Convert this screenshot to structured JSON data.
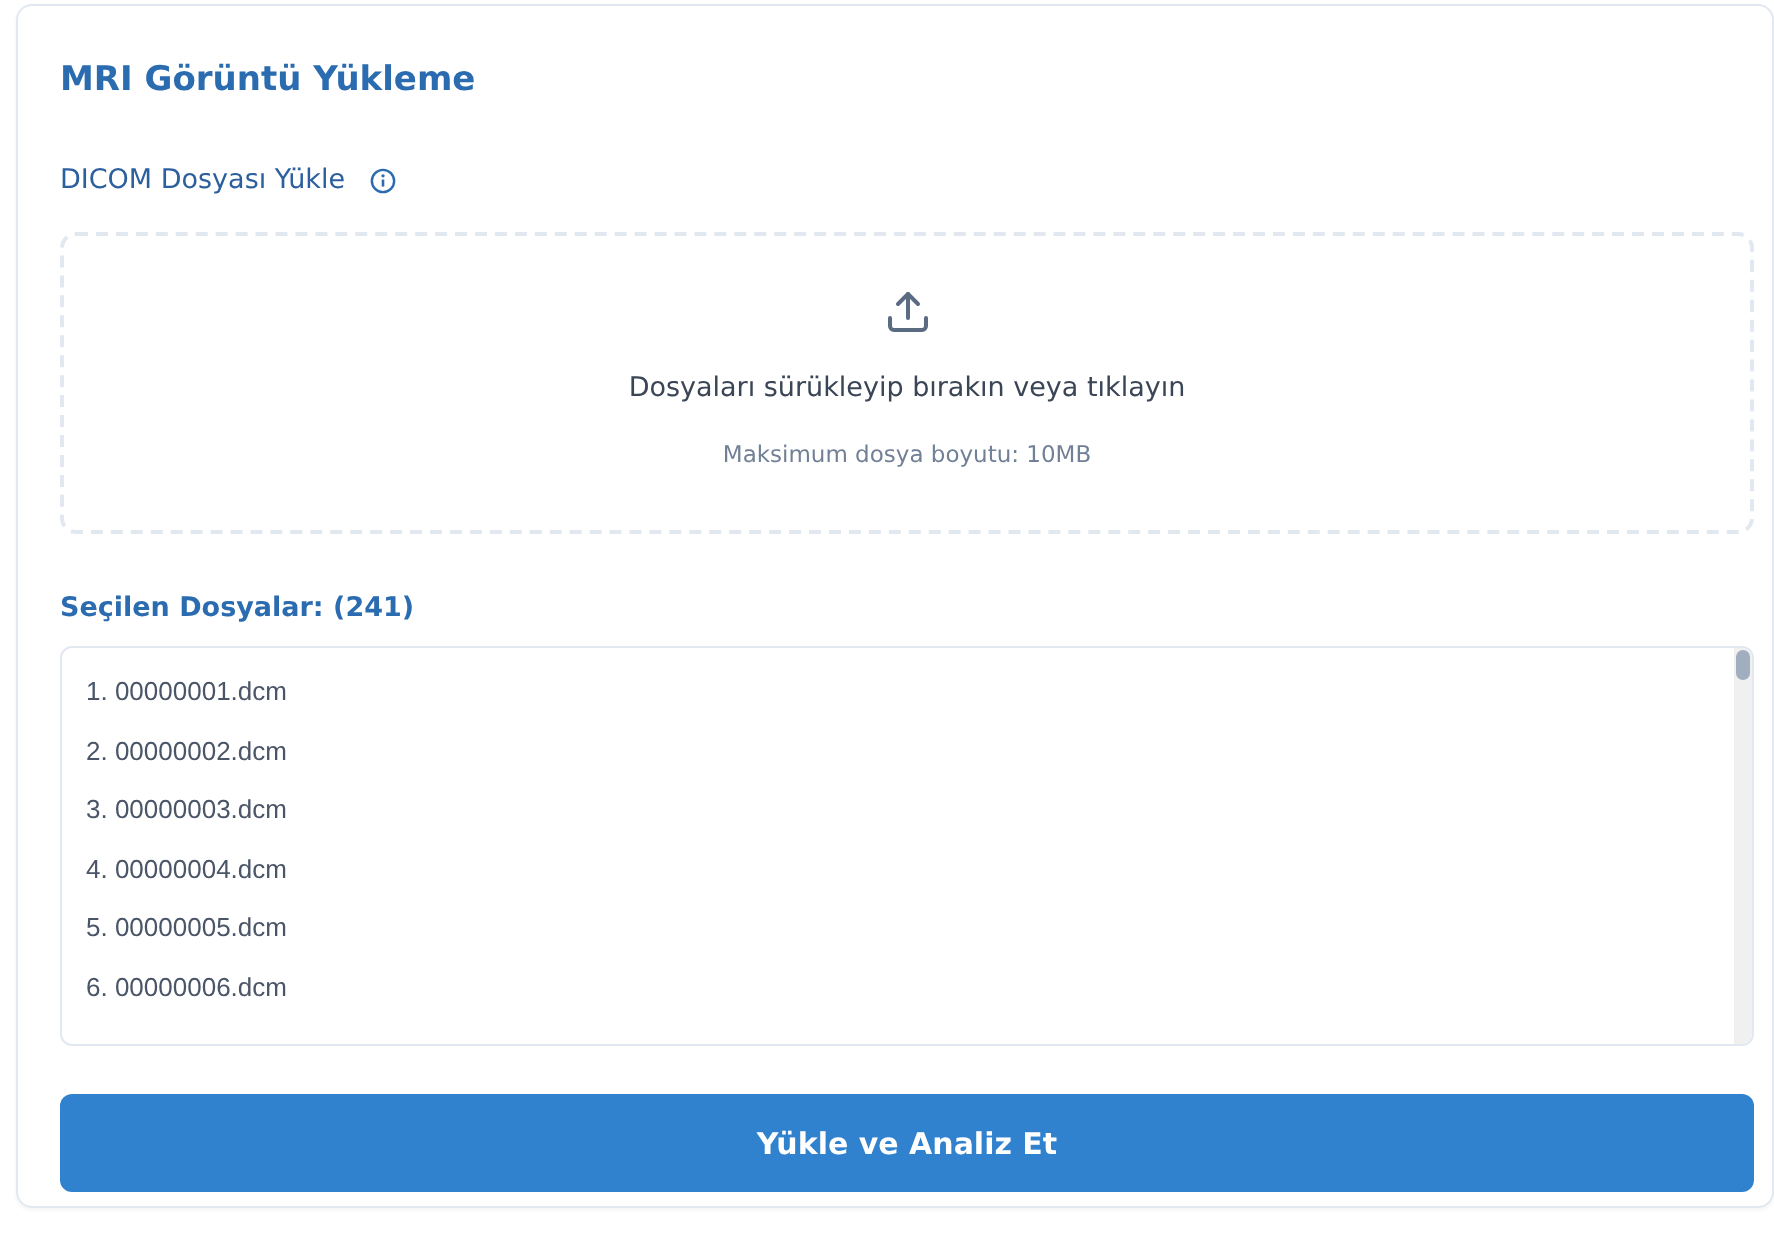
{
  "title": "MRI Görüntü Yükleme",
  "upload_label": "DICOM Dosyası Yükle",
  "dropzone": {
    "text": "Dosyaları sürükleyip bırakın veya tıklayın",
    "hint": "Maksimum dosya boyutu: 10MB"
  },
  "selected_heading": "Seçilen Dosyalar: (241)",
  "files": [
    "1. 00000001.dcm",
    "2. 00000002.dcm",
    "3. 00000003.dcm",
    "4. 00000004.dcm",
    "5. 00000005.dcm",
    "6. 00000006.dcm"
  ],
  "button": "Yükle ve Analiz Et"
}
